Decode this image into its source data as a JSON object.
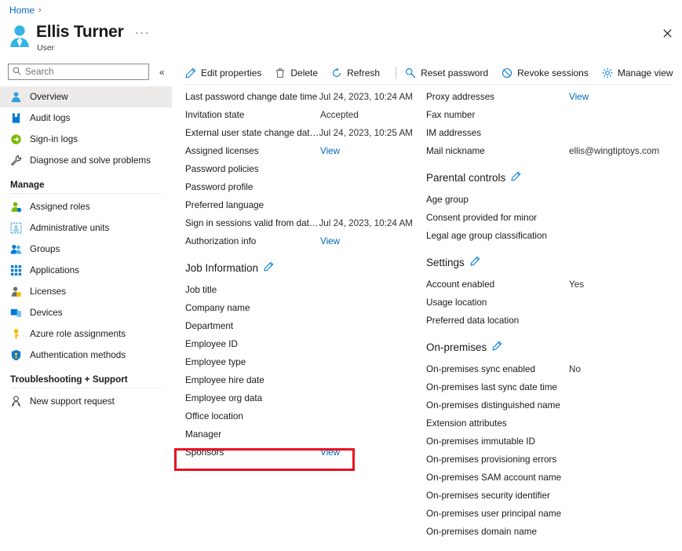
{
  "breadcrumb": {
    "home": "Home",
    "separator": "›"
  },
  "header": {
    "title": "Ellis Turner",
    "subtitle": "User",
    "ellipsis": "···",
    "avatar_icon": "user-avatar-icon",
    "close_icon": "close-icon",
    "close_glyph": "✕"
  },
  "search": {
    "placeholder": "Search",
    "value": "",
    "icon": "search-icon"
  },
  "collapse": {
    "glyph": "«",
    "label": "Collapse navigation"
  },
  "sidebar": {
    "items": [
      {
        "label": "Overview",
        "icon": "user-icon",
        "selected": true
      },
      {
        "label": "Audit logs",
        "icon": "book-icon",
        "selected": false
      },
      {
        "label": "Sign-in logs",
        "icon": "sign-in-icon",
        "selected": false
      },
      {
        "label": "Diagnose and solve problems",
        "icon": "wrench-icon",
        "selected": false
      }
    ],
    "groups": [
      {
        "title": "Manage",
        "items": [
          {
            "label": "Assigned roles",
            "icon": "assigned-roles-icon"
          },
          {
            "label": "Administrative units",
            "icon": "administrative-units-icon"
          },
          {
            "label": "Groups",
            "icon": "groups-icon"
          },
          {
            "label": "Applications",
            "icon": "applications-grid-icon"
          },
          {
            "label": "Licenses",
            "icon": "licenses-icon"
          },
          {
            "label": "Devices",
            "icon": "devices-icon"
          },
          {
            "label": "Azure role assignments",
            "icon": "key-icon"
          },
          {
            "label": "Authentication methods",
            "icon": "shield-icon"
          }
        ]
      },
      {
        "title": "Troubleshooting + Support",
        "items": [
          {
            "label": "New support request",
            "icon": "support-person-icon"
          }
        ]
      }
    ]
  },
  "toolbar": {
    "buttons": [
      {
        "label": "Edit properties",
        "icon": "pencil-icon"
      },
      {
        "label": "Delete",
        "icon": "trash-icon"
      },
      {
        "label": "Refresh",
        "icon": "refresh-icon"
      },
      {
        "label": "Reset password",
        "icon": "key-search-icon"
      },
      {
        "label": "Revoke sessions",
        "icon": "block-icon"
      },
      {
        "label": "Manage view",
        "icon": "gear-icon"
      }
    ],
    "overflow": "···"
  },
  "left_column": [
    {
      "type": "kv",
      "label": "Last password change date time",
      "value": "Jul 24, 2023, 10:24 AM",
      "link": false
    },
    {
      "type": "kv",
      "label": "Invitation state",
      "value": "Accepted",
      "link": false
    },
    {
      "type": "kv",
      "label": "External user state change date ...",
      "value": "Jul 24, 2023, 10:25 AM",
      "link": false
    },
    {
      "type": "kv",
      "label": "Assigned licenses",
      "value": "View",
      "link": true
    },
    {
      "type": "kv",
      "label": "Password policies",
      "value": "",
      "link": false
    },
    {
      "type": "kv",
      "label": "Password profile",
      "value": "",
      "link": false
    },
    {
      "type": "kv",
      "label": "Preferred language",
      "value": "",
      "link": false
    },
    {
      "type": "kv",
      "label": "Sign in sessions valid from date ...",
      "value": "Jul 24, 2023, 10:24 AM",
      "link": false
    },
    {
      "type": "kv",
      "label": "Authorization info",
      "value": "View",
      "link": true
    },
    {
      "type": "section",
      "label": "Job Information",
      "icon": "pencil-icon"
    },
    {
      "type": "kv",
      "label": "Job title",
      "value": "",
      "link": false
    },
    {
      "type": "kv",
      "label": "Company name",
      "value": "",
      "link": false
    },
    {
      "type": "kv",
      "label": "Department",
      "value": "",
      "link": false
    },
    {
      "type": "kv",
      "label": "Employee ID",
      "value": "",
      "link": false
    },
    {
      "type": "kv",
      "label": "Employee type",
      "value": "",
      "link": false
    },
    {
      "type": "kv",
      "label": "Employee hire date",
      "value": "",
      "link": false
    },
    {
      "type": "kv",
      "label": "Employee org data",
      "value": "",
      "link": false
    },
    {
      "type": "kv",
      "label": "Office location",
      "value": "",
      "link": false
    },
    {
      "type": "kv",
      "label": "Manager",
      "value": "",
      "link": false
    },
    {
      "type": "kv",
      "label": "Sponsors",
      "value": "View",
      "link": true,
      "highlighted": true
    }
  ],
  "right_column": [
    {
      "type": "kv",
      "label": "Proxy addresses",
      "value": "View",
      "link": true
    },
    {
      "type": "kv",
      "label": "Fax number",
      "value": "",
      "link": false
    },
    {
      "type": "kv",
      "label": "IM addresses",
      "value": "",
      "link": false
    },
    {
      "type": "kv",
      "label": "Mail nickname",
      "value": "ellis@wingtiptoys.com",
      "link": false
    },
    {
      "type": "section",
      "label": "Parental controls",
      "icon": "pencil-icon"
    },
    {
      "type": "kv",
      "label": "Age group",
      "value": "",
      "link": false
    },
    {
      "type": "kv",
      "label": "Consent provided for minor",
      "value": "",
      "link": false
    },
    {
      "type": "kv",
      "label": "Legal age group classification",
      "value": "",
      "link": false
    },
    {
      "type": "section",
      "label": "Settings",
      "icon": "pencil-icon"
    },
    {
      "type": "kv",
      "label": "Account enabled",
      "value": "Yes",
      "link": false
    },
    {
      "type": "kv",
      "label": "Usage location",
      "value": "",
      "link": false
    },
    {
      "type": "kv",
      "label": "Preferred data location",
      "value": "",
      "link": false
    },
    {
      "type": "section",
      "label": "On-premises",
      "icon": "pencil-icon"
    },
    {
      "type": "kv",
      "label": "On-premises sync enabled",
      "value": "No",
      "link": false
    },
    {
      "type": "kv",
      "label": "On-premises last sync date time",
      "value": "",
      "link": false
    },
    {
      "type": "kv",
      "label": "On-premises distinguished name",
      "value": "",
      "link": false
    },
    {
      "type": "kv",
      "label": "Extension attributes",
      "value": "",
      "link": false
    },
    {
      "type": "kv",
      "label": "On-premises immutable ID",
      "value": "",
      "link": false
    },
    {
      "type": "kv",
      "label": "On-premises provisioning errors",
      "value": "",
      "link": false
    },
    {
      "type": "kv",
      "label": "On-premises SAM account name",
      "value": "",
      "link": false
    },
    {
      "type": "kv",
      "label": "On-premises security identifier",
      "value": "",
      "link": false
    },
    {
      "type": "kv",
      "label": "On-premises user principal name",
      "value": "",
      "link": false
    },
    {
      "type": "kv",
      "label": "On-premises domain name",
      "value": "",
      "link": false
    }
  ],
  "annotation": {
    "highlight_color": "#e81123",
    "highlight_target": "Sponsors"
  },
  "colors": {
    "link": "#0067b8",
    "accent": "#0078d4",
    "selected_bg": "#edebe9",
    "text": "#1b1a19"
  }
}
